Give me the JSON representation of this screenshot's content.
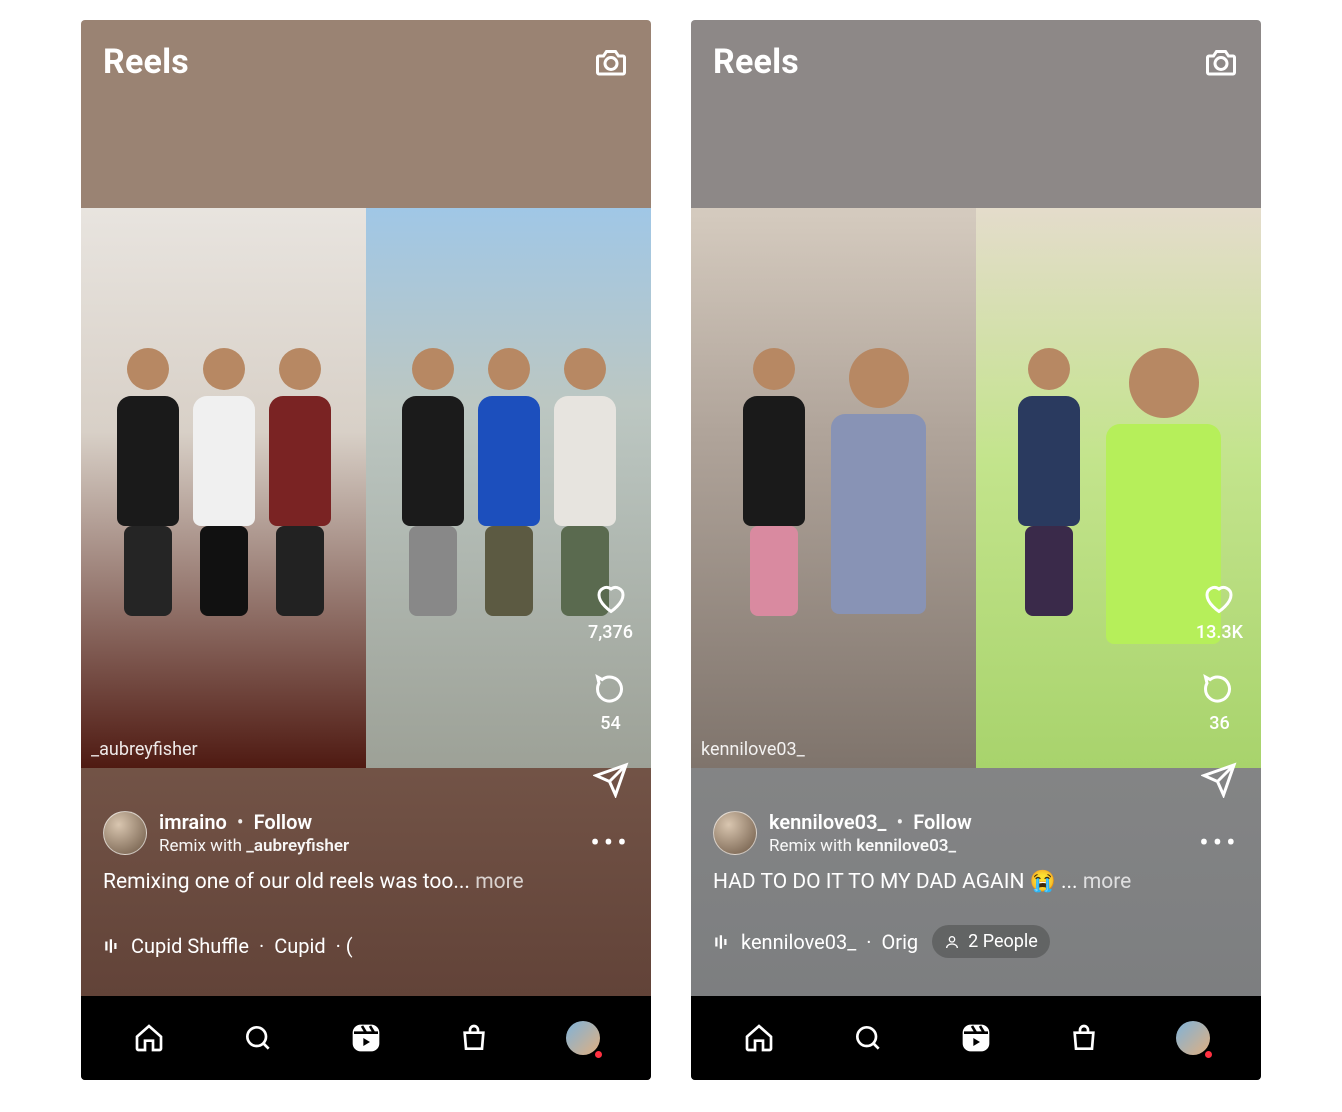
{
  "screens": [
    {
      "header": {
        "title": "Reels"
      },
      "video": {
        "left_watermark": "_aubreyfisher",
        "right_watermark": ""
      },
      "actions": {
        "likes": "7,376",
        "comments": "54"
      },
      "user": {
        "username": "imraino",
        "follow_label": "Follow",
        "remix_prefix": "Remix with",
        "remix_user": "_aubreyfisher"
      },
      "caption": {
        "text": "Remixing one of our old reels was too...",
        "more": "more"
      },
      "audio": {
        "track": "Cupid Shuffle",
        "artist": "Cupid",
        "tail": "· ("
      }
    },
    {
      "header": {
        "title": "Reels"
      },
      "video": {
        "left_watermark": "kennilove03_",
        "right_watermark": ""
      },
      "actions": {
        "likes": "13.3K",
        "comments": "36"
      },
      "user": {
        "username": "kennilove03_",
        "follow_label": "Follow",
        "remix_prefix": "Remix with",
        "remix_user": "kennilove03_"
      },
      "caption": {
        "text": "HAD TO DO IT TO MY DAD AGAIN 😭 ...",
        "more": "more"
      },
      "audio": {
        "track": "kennilove03_",
        "artist": "Orig",
        "tail": "·"
      },
      "tagged": {
        "label": "2 People"
      }
    }
  ]
}
